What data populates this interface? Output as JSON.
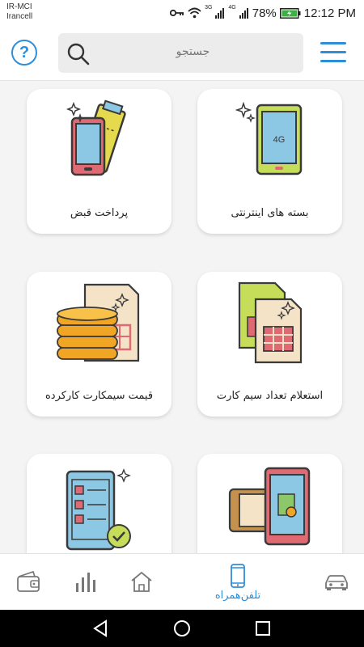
{
  "status_bar": {
    "carrier_1": "IR-MCI",
    "carrier_2": "Irancell",
    "net_1": "3G",
    "net_2": "4G",
    "battery": "78%",
    "time": "12:12 PM"
  },
  "header": {
    "help_icon": "question-circle-icon",
    "search_placeholder": "جستجو",
    "menu_icon": "hamburger-menu-icon"
  },
  "services": [
    {
      "label": "بسته های اینترنتی",
      "icon": "phone-4g-icon"
    },
    {
      "label": "پرداخت قبض",
      "icon": "phone-ticket-icon"
    },
    {
      "label": "استعلام تعداد سیم کارت",
      "icon": "sim-cards-icon"
    },
    {
      "label": "قیمت سیمکارت کارکرده",
      "icon": "coins-sim-icon"
    },
    {
      "label": "",
      "icon": "phone-tablet-money-icon"
    },
    {
      "label": "",
      "icon": "checklist-phone-icon"
    }
  ],
  "icon_badge": "4G",
  "bottom_nav": [
    {
      "icon": "car-icon",
      "label": ""
    },
    {
      "icon": "phone-icon",
      "label": "تلفن‌همراه",
      "active": true
    },
    {
      "icon": "home-icon",
      "label": ""
    },
    {
      "icon": "bar-chart-icon",
      "label": ""
    },
    {
      "icon": "wallet-icon",
      "label": ""
    }
  ],
  "colors": {
    "accent": "#2f8ed8",
    "background": "#f4f4f4",
    "card": "#ffffff"
  }
}
